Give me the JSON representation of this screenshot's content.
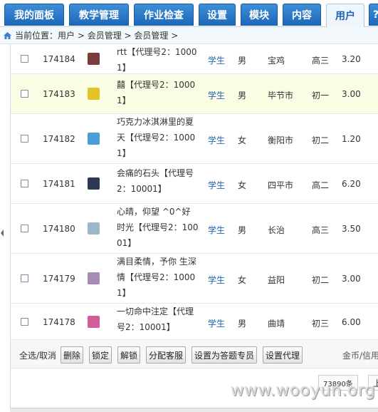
{
  "nav": {
    "tabs": [
      {
        "label": "我的面板"
      },
      {
        "label": "教学管理"
      },
      {
        "label": "作业检查"
      },
      {
        "label": "设置"
      },
      {
        "label": "模块"
      },
      {
        "label": "内容"
      },
      {
        "label": "用户",
        "active": true
      },
      {
        "label": "?"
      }
    ]
  },
  "breadcrumb": {
    "prefix": "当前位置：",
    "path": "用户 > 会员管理 > 会员管理 >"
  },
  "rows": [
    {
      "id": "174184",
      "name": "rtt【代理号2：10001】",
      "role": "学生",
      "sex": "男",
      "city": "宝鸡",
      "grade": "高三",
      "money": "3.20",
      "avatar_color": "#7a3b3b"
    },
    {
      "id": "174183",
      "name": "囍【代理号2：10001】",
      "role": "学生",
      "sex": "男",
      "city": "毕节市",
      "grade": "初一",
      "money": "3.00",
      "avatar_color": "#e0c42a"
    },
    {
      "id": "174182",
      "name": "巧克力冰淇淋里的夏天【代理号2：10001】",
      "role": "学生",
      "sex": "女",
      "city": "衡阳市",
      "grade": "初二",
      "money": "1.20",
      "avatar_color": "#4a9ed8"
    },
    {
      "id": "174181",
      "name": "会痛的石头【代理号2：10001】",
      "role": "学生",
      "sex": "女",
      "city": "四平市",
      "grade": "高二",
      "money": "6.20",
      "avatar_color": "#2e3a52"
    },
    {
      "id": "174180",
      "name": "心晴，仰望 ^0^好时光【代理号2：10001】",
      "role": "学生",
      "sex": "男",
      "city": "长治",
      "grade": "高三",
      "money": "3.50",
      "avatar_color": "#9cb8c8"
    },
    {
      "id": "174179",
      "name": "满目柔情，予你 生深情【代理号2：10001】",
      "role": "学生",
      "sex": "女",
      "city": "益阳",
      "grade": "初二",
      "money": "3.00",
      "avatar_color": "#a88ab8"
    },
    {
      "id": "174178",
      "name": "一切命中注定【代理号2：10001】",
      "role": "学生",
      "sex": "男",
      "city": "曲靖",
      "grade": "初三",
      "money": "6.00",
      "avatar_color": "#d45a9a"
    }
  ],
  "actions": {
    "select_all": "全选/取消",
    "delete": "删除",
    "lock": "锁定",
    "unlock": "解锁",
    "assign_service": "分配客服",
    "set_expert": "设置为答题专员",
    "set_agent": "设置代理",
    "coin_label": "金币/信用"
  },
  "pager": {
    "total": "73890条",
    "prev": "上"
  },
  "watermark": "www.wooyun.org"
}
